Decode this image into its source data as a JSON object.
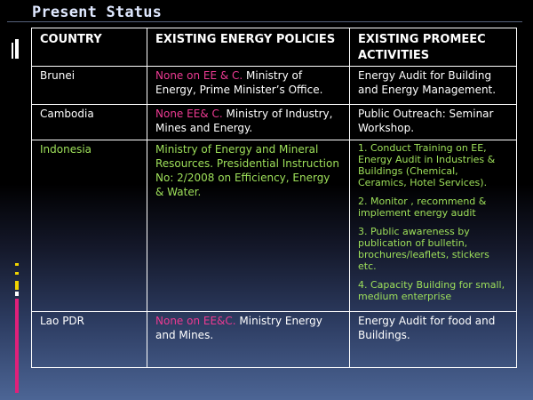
{
  "slide": {
    "title": "Present Status"
  },
  "table": {
    "headers": {
      "country": "COUNTRY",
      "policies": "EXISTING ENERGY POLICIES",
      "activities": "EXISTING PROMEEC ACTIVITIES"
    },
    "rows": [
      {
        "country": "Brunei",
        "policy_highlight": "None on EE & C.",
        "policy_text": " Ministry of Energy, Prime Minister’s Office.",
        "activities": [
          "Energy Audit for Building and Energy Management."
        ]
      },
      {
        "country": "Cambodia",
        "policy_highlight": "None EE& C.",
        "policy_text": " Ministry of Industry, Mines and Energy.",
        "activities": [
          "Public Outreach: Seminar Workshop."
        ]
      },
      {
        "country": "Indonesia",
        "policy_highlight": "",
        "policy_text": "Ministry of Energy and Mineral Resources.  Presidential Instruction No: 2/2008 on  Efficiency,  Energy  & Water.",
        "activities": [
          "1. Conduct Training on EE, Energy Audit in Industries & Buildings (Chemical, Ceramics, Hotel Services).",
          "2. Monitor , recommend & implement energy audit",
          "3. Public awareness by publication of bulletin, brochures/leaflets, stickers etc.",
          "4. Capacity Building for small, medium enterprise"
        ]
      },
      {
        "country": "Lao PDR",
        "policy_highlight": "None on EE&C.",
        "policy_text": " Ministry Energy and Mines.",
        "activities": [
          "Energy Audit for food and Buildings."
        ]
      }
    ]
  },
  "colors": {
    "highlight_pink": "#ec3a92",
    "highlight_green": "#9ee05a",
    "title_color": "#dfe8ff"
  }
}
